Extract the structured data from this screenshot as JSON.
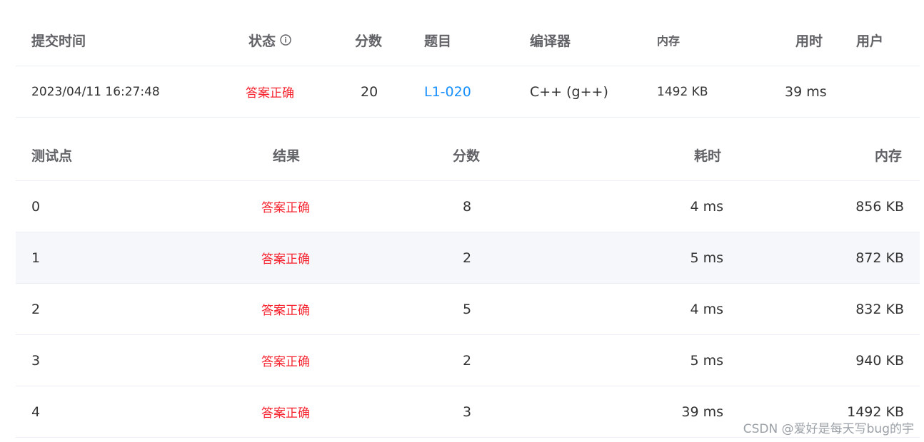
{
  "submission": {
    "headers": {
      "submit_time": "提交时间",
      "status": "状态",
      "score": "分数",
      "problem": "题目",
      "compiler": "编译器",
      "memory": "内存",
      "time": "用时",
      "user": "用户"
    },
    "row": {
      "submit_time": "2023/04/11 16:27:48",
      "status": "答案正确",
      "score": "20",
      "problem": "L1-020",
      "compiler": "C++ (g++)",
      "memory": "1492 KB",
      "time": "39 ms",
      "user": ""
    }
  },
  "testcases": {
    "headers": {
      "case": "测试点",
      "result": "结果",
      "score": "分数",
      "time": "耗时",
      "memory": "内存"
    },
    "rows": [
      {
        "case": "0",
        "result": "答案正确",
        "score": "8",
        "time": "4 ms",
        "memory": "856 KB"
      },
      {
        "case": "1",
        "result": "答案正确",
        "score": "2",
        "time": "5 ms",
        "memory": "872 KB"
      },
      {
        "case": "2",
        "result": "答案正确",
        "score": "5",
        "time": "4 ms",
        "memory": "832 KB"
      },
      {
        "case": "3",
        "result": "答案正确",
        "score": "2",
        "time": "5 ms",
        "memory": "940 KB"
      },
      {
        "case": "4",
        "result": "答案正确",
        "score": "3",
        "time": "39 ms",
        "memory": "1492 KB"
      }
    ]
  },
  "watermark": "CSDN @爱好是每天写bug的宇",
  "colors": {
    "accepted": "#f5222d",
    "link": "#1890ff",
    "alt_row": "#f5f7fa"
  }
}
